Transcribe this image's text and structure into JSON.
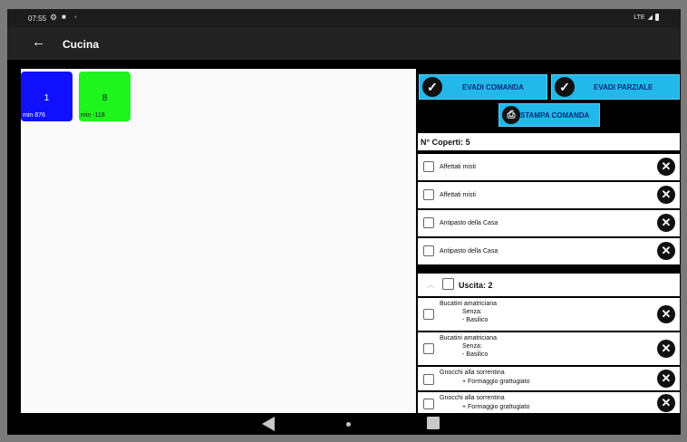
{
  "statusbar": {
    "time": "07:55",
    "network": "LTE"
  },
  "appbar": {
    "title": "Cucina"
  },
  "tiles": [
    {
      "number": "1",
      "min": "min 876",
      "color": "#1010ff"
    },
    {
      "number": "8",
      "min": "min -118",
      "color": "#1ef41e"
    }
  ],
  "actions": {
    "evadi": "EVADI COMANDA",
    "parziale": "EVADI PARZIALE",
    "stampa": "STAMPA COMANDA"
  },
  "coperti": "N° Coperti: 5",
  "items": [
    {
      "name": "Affettati misti"
    },
    {
      "name": "Affettati misti"
    },
    {
      "name": "Antipasto della Casa"
    },
    {
      "name": "Antipasto della Casa"
    }
  ],
  "group": {
    "label": "Uscita: 2"
  },
  "group_items": [
    {
      "name": "Bucatini amatriciana",
      "line1": "Senza:",
      "line2": "- Basilico"
    },
    {
      "name": "Bucatini amatriciana",
      "line1": "Senza:",
      "line2": "- Basilico"
    },
    {
      "name": "Gnocchi alla sorrentina",
      "line1": "+ Formaggio grattugiato"
    },
    {
      "name": "Gnocchi alla sorrentina",
      "line1": "+ Formaggio grattugiato"
    }
  ],
  "colors": {
    "accent": "#22b8ea",
    "appbar": "#222222",
    "status_bar": "#1c1c1c"
  },
  "icons": {
    "back": "arrow-left-icon",
    "check": "check-circle-icon",
    "print": "printer-icon",
    "delete": "close-circle-icon",
    "expand": "chevron-up-icon"
  }
}
